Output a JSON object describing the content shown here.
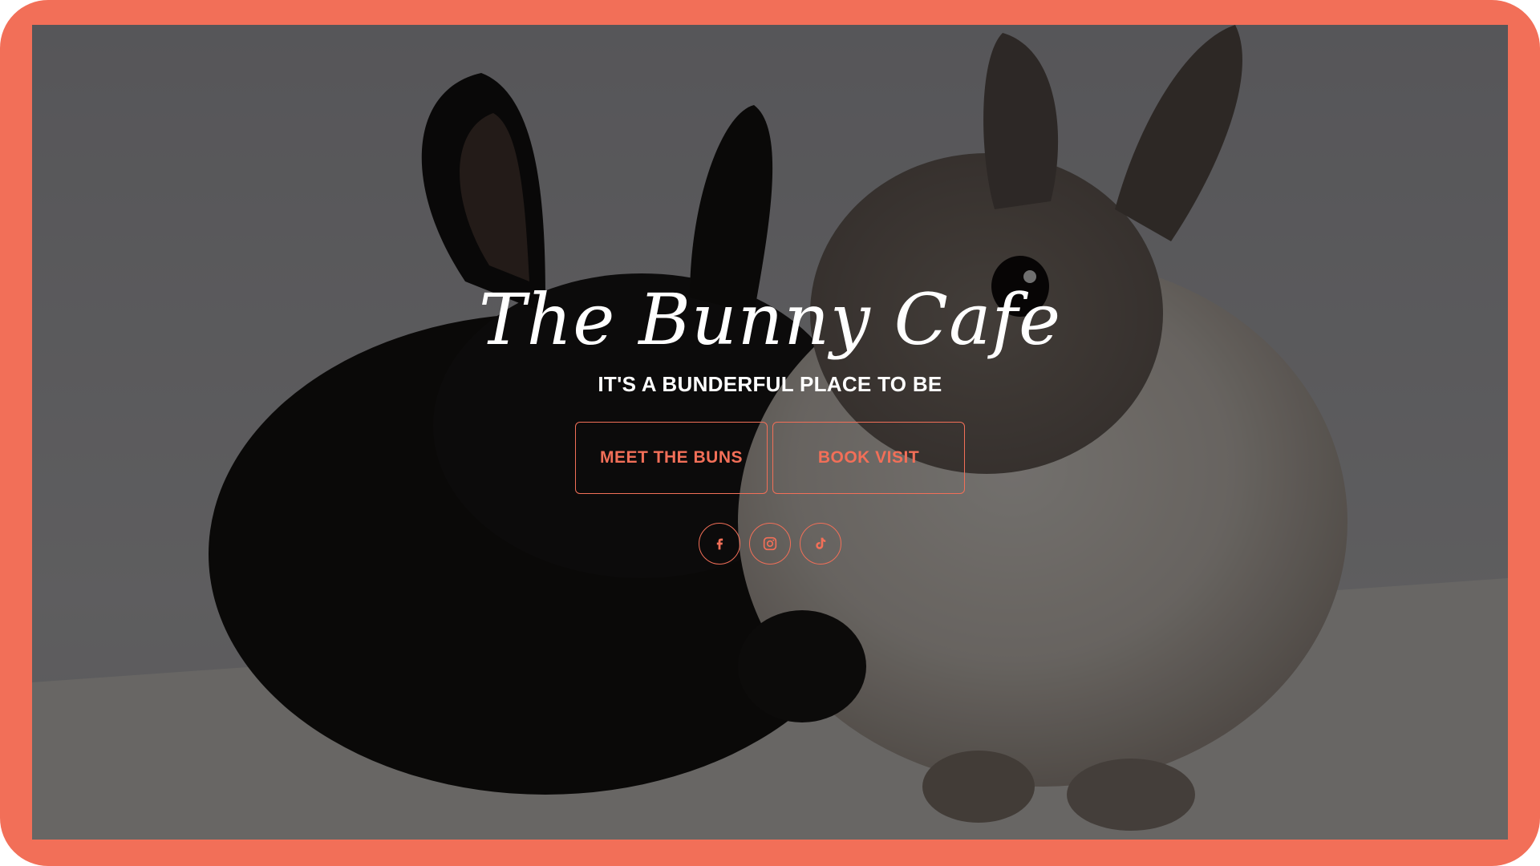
{
  "brand": {
    "title": "The Bunny Cafe",
    "tagline": "IT'S A BUNDERFUL PLACE TO BE"
  },
  "actions": {
    "meet_label": "MEET THE BUNS",
    "book_label": "BOOK VISIT"
  },
  "socials": [
    {
      "icon": "facebook-icon"
    },
    {
      "icon": "instagram-icon"
    },
    {
      "icon": "tiktok-icon"
    }
  ],
  "colors": {
    "accent": "#f26f58",
    "text": "#ffffff"
  }
}
